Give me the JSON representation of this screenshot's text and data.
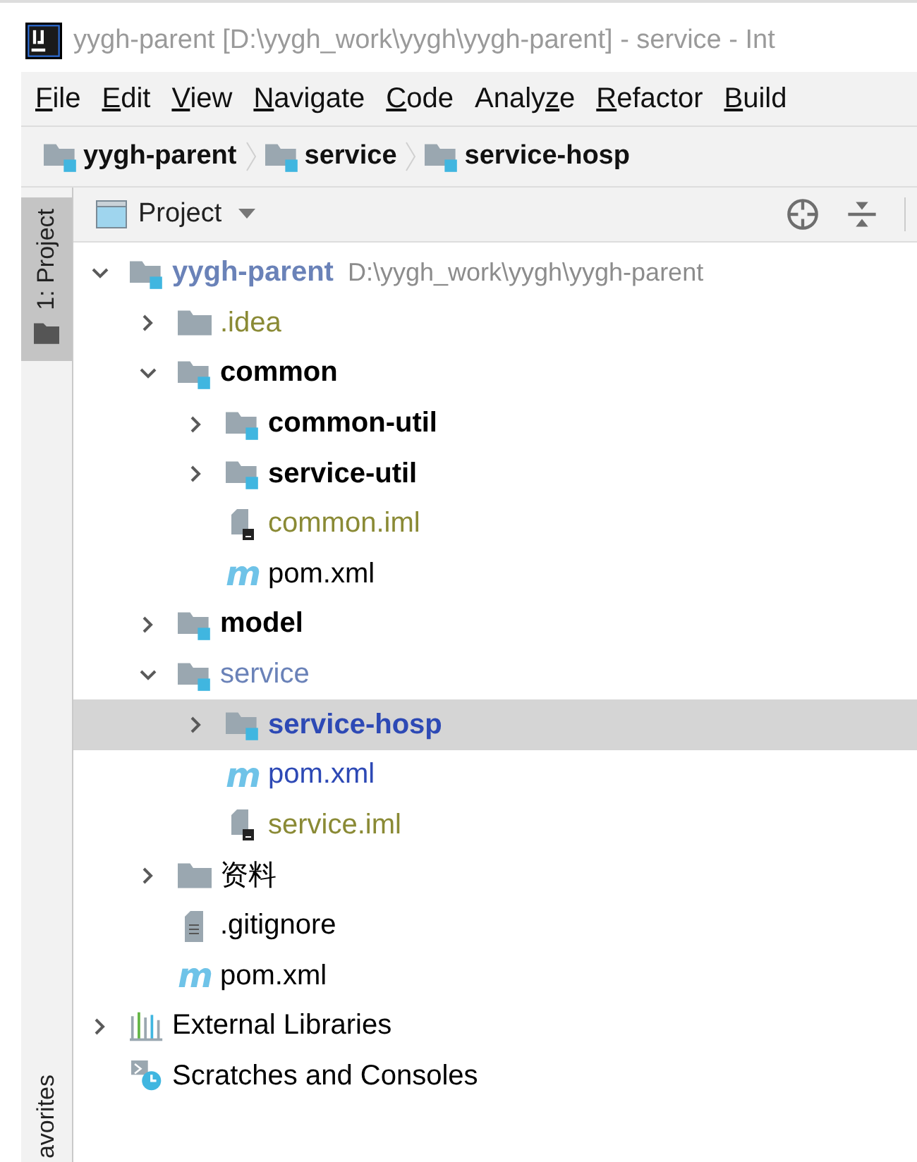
{
  "window": {
    "title": "yygh-parent [D:\\yygh_work\\yygh\\yygh-parent] - service - Int"
  },
  "menu": [
    {
      "key": "F",
      "post": "ile"
    },
    {
      "key": "E",
      "post": "dit"
    },
    {
      "key": "V",
      "post": "iew"
    },
    {
      "key": "N",
      "post": "avigate"
    },
    {
      "key": "C",
      "post": "ode"
    },
    {
      "pre": "Analy",
      "key": "z",
      "post": "e"
    },
    {
      "key": "R",
      "post": "efactor"
    },
    {
      "key": "B",
      "post": "uild"
    }
  ],
  "breadcrumbs": [
    "yygh-parent",
    "service",
    "service-hosp"
  ],
  "side_tabs": [
    {
      "label": "1: Project",
      "selected": true
    },
    {
      "label": "avorites",
      "selected": false
    }
  ],
  "panel": {
    "title": "Project"
  },
  "tree": [
    {
      "label": "yygh-parent",
      "location": "D:\\yygh_work\\yygh\\yygh-parent",
      "kind": "module",
      "bold": true,
      "color": "#6a82b8",
      "expanded": true,
      "selected": false,
      "children": [
        {
          "label": ".idea",
          "kind": "folder",
          "bold": false,
          "color": "#8a8a35",
          "expanded": false,
          "selected": false
        },
        {
          "label": "common",
          "kind": "module",
          "bold": true,
          "color": "#000000",
          "expanded": true,
          "selected": false,
          "children": [
            {
              "label": "common-util",
              "kind": "module",
              "bold": true,
              "color": "#000000",
              "expanded": false,
              "selected": false
            },
            {
              "label": "service-util",
              "kind": "module",
              "bold": true,
              "color": "#000000",
              "expanded": false,
              "selected": false
            },
            {
              "label": "common.iml",
              "kind": "iml",
              "bold": false,
              "color": "#8a8a35",
              "selected": false
            },
            {
              "label": "pom.xml",
              "kind": "pom",
              "icon_glyph": "m",
              "bold": false,
              "color": "#000000",
              "selected": false
            }
          ]
        },
        {
          "label": "model",
          "kind": "module",
          "bold": true,
          "color": "#000000",
          "expanded": false,
          "selected": false
        },
        {
          "label": "service",
          "kind": "module",
          "bold": false,
          "color": "#6a82b8",
          "expanded": true,
          "selected": false,
          "children": [
            {
              "label": "service-hosp",
              "kind": "module",
              "bold": true,
              "color": "#2d49b5",
              "expanded": false,
              "selected": true
            },
            {
              "label": "pom.xml",
              "kind": "pom",
              "icon_glyph": "m",
              "bold": false,
              "color": "#2d49b5",
              "selected": false
            },
            {
              "label": "service.iml",
              "kind": "iml",
              "bold": false,
              "color": "#8a8a35",
              "selected": false
            }
          ]
        },
        {
          "label": "资料",
          "kind": "folder",
          "bold": false,
          "color": "#000000",
          "expanded": false,
          "selected": false
        },
        {
          "label": ".gitignore",
          "kind": "text",
          "bold": false,
          "color": "#000000",
          "selected": false
        },
        {
          "label": "pom.xml",
          "kind": "pom",
          "icon_glyph": "m",
          "bold": false,
          "color": "#000000",
          "selected": false
        }
      ]
    },
    {
      "label": "External Libraries",
      "kind": "libraries",
      "bold": false,
      "color": "#000000",
      "expanded": false,
      "selected": false
    },
    {
      "label": "Scratches and Consoles",
      "kind": "scratches",
      "bold": false,
      "color": "#000000",
      "selected": false
    }
  ]
}
